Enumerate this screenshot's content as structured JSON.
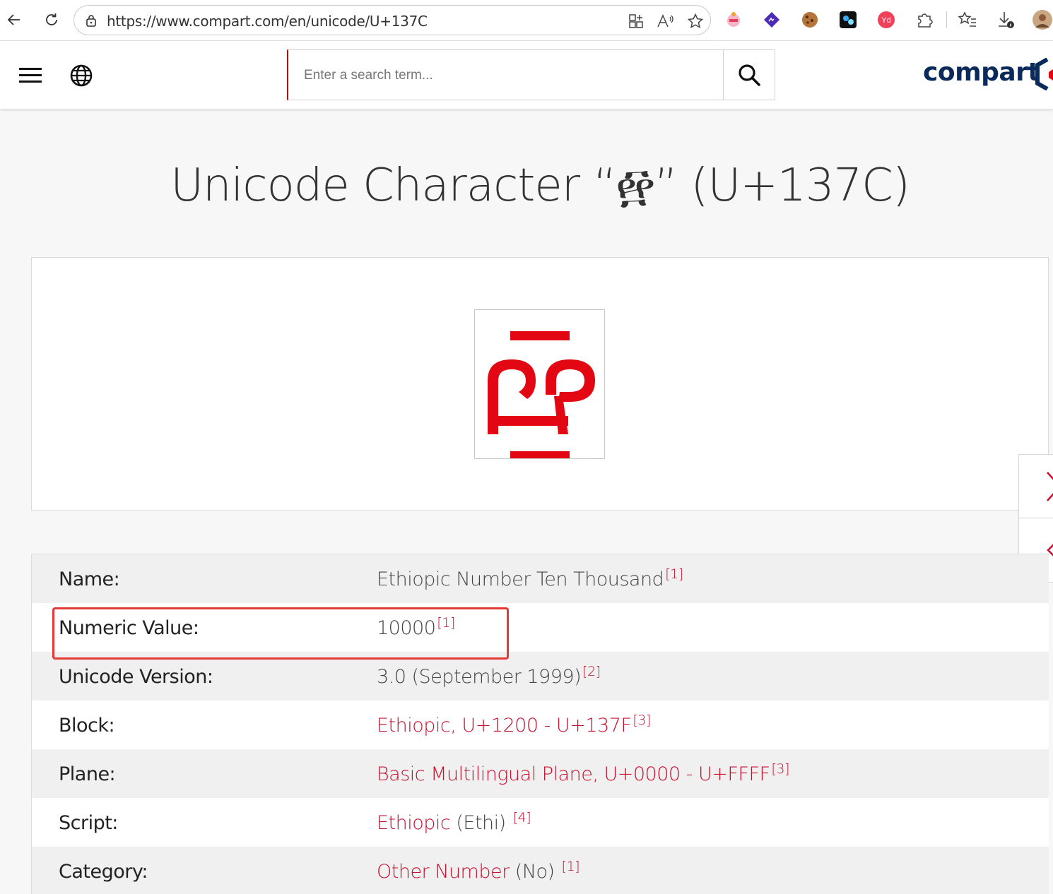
{
  "browser": {
    "url": "https://www.compart.com/en/unicode/U+137C"
  },
  "header": {
    "search_placeholder": "Enter a search term...",
    "logo_text": "compart"
  },
  "page": {
    "title": "Unicode Character “፼” (U+137C)",
    "glyph": "፼",
    "accent_color": "#e30613"
  },
  "properties": [
    {
      "label": "Name:",
      "value": "Ethiopic Number Ten Thousand",
      "value_is_link": false,
      "suffix": "",
      "ref": "[1]"
    },
    {
      "label": "Numeric Value:",
      "value": "10000",
      "value_is_link": false,
      "suffix": "",
      "ref": "[1]"
    },
    {
      "label": "Unicode Version:",
      "value": "3.0 (September 1999)",
      "value_is_link": false,
      "suffix": "",
      "ref": "[2]"
    },
    {
      "label": "Block:",
      "value": "Ethiopic, U+1200 - U+137F",
      "value_is_link": true,
      "suffix": "",
      "ref": "[3]"
    },
    {
      "label": "Plane:",
      "value": "Basic Multilingual Plane, U+0000 - U+FFFF",
      "value_is_link": true,
      "suffix": "",
      "ref": "[3]"
    },
    {
      "label": "Script:",
      "value": "Ethiopic",
      "value_is_link": true,
      "suffix": " (Ethi) ",
      "ref": "[4]"
    },
    {
      "label": "Category:",
      "value": "Other Number",
      "value_is_link": true,
      "suffix": " (No) ",
      "ref": "[1]"
    }
  ]
}
